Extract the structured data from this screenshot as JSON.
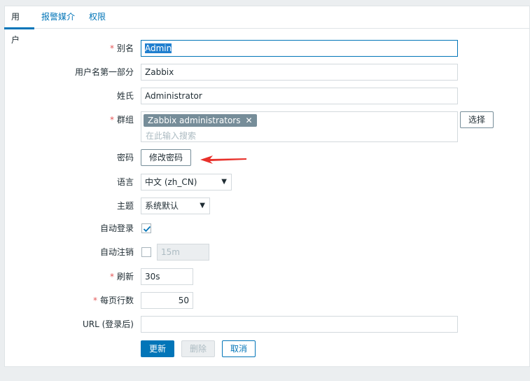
{
  "tabs": [
    {
      "label": "用户"
    },
    {
      "label": "报警媒介"
    },
    {
      "label": "权限"
    }
  ],
  "form": {
    "alias": {
      "label": "别名",
      "value": "Admin",
      "required": "*"
    },
    "name": {
      "label": "用户名第一部分",
      "value": "Zabbix"
    },
    "surname": {
      "label": "姓氏",
      "value": "Administrator"
    },
    "groups": {
      "label": "群组",
      "required": "*",
      "chip": "Zabbix administrators",
      "placeholder": "在此输入搜索",
      "select_button": "选择"
    },
    "password": {
      "label": "密码",
      "button": "修改密码"
    },
    "language": {
      "label": "语言",
      "value": "中文 (zh_CN)"
    },
    "theme": {
      "label": "主题",
      "value": "系统默认"
    },
    "autologin": {
      "label": "自动登录",
      "checked": true
    },
    "autologout": {
      "label": "自动注销",
      "checked": false,
      "value": "15m"
    },
    "refresh": {
      "label": "刷新",
      "value": "30s",
      "required": "*"
    },
    "rows_per_page": {
      "label": "每页行数",
      "value": "50",
      "required": "*"
    },
    "url": {
      "label": "URL (登录后)",
      "value": ""
    }
  },
  "actions": {
    "update": "更新",
    "delete": "删除",
    "cancel": "取消"
  },
  "colors": {
    "accent": "#0275b8",
    "required": "#e45959",
    "annotation_arrow": "#e8302a"
  }
}
